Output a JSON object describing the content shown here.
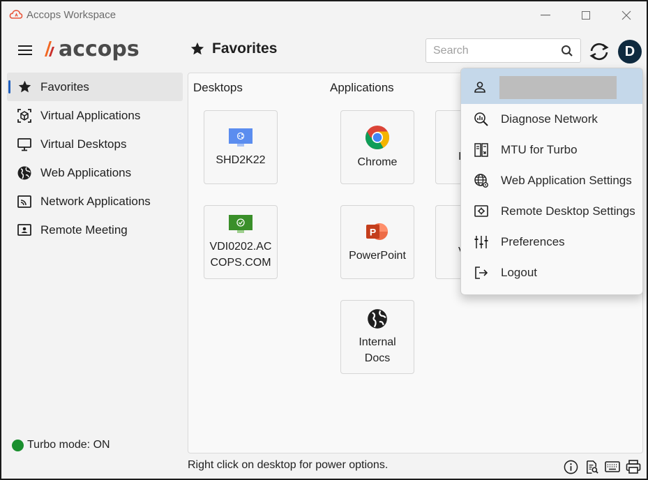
{
  "window": {
    "title": "Accops Workspace",
    "controls": [
      "minimize",
      "maximize",
      "close"
    ]
  },
  "header": {
    "logo_text": "accops",
    "page_title": "Favorites",
    "search_placeholder": "Search",
    "avatar_letter": "D"
  },
  "sidebar": {
    "items": [
      {
        "label": "Favorites",
        "icon": "star-icon",
        "active": true
      },
      {
        "label": "Virtual Applications",
        "icon": "cube-icon"
      },
      {
        "label": "Virtual Desktops",
        "icon": "monitor-icon"
      },
      {
        "label": "Web Applications",
        "icon": "globe-icon"
      },
      {
        "label": "Network Applications",
        "icon": "cast-icon"
      },
      {
        "label": "Remote Meeting",
        "icon": "presentation-icon"
      }
    ],
    "turbo_status": "Turbo mode: ON",
    "turbo_color": "#1a8f2e"
  },
  "main": {
    "desktops_heading": "Desktops",
    "applications_heading": "Applications",
    "desktops": [
      {
        "label": "SHD2K22",
        "icon": "shared-desktop-icon",
        "color": "#5b8def"
      },
      {
        "label": "VDI0202.AC\nCOPS.COM",
        "icon": "vdi-desktop-icon",
        "color": "#3a8f2a"
      }
    ],
    "applications": [
      {
        "label": "Chrome",
        "icon": "chrome-icon"
      },
      {
        "label": "PowerPoint",
        "icon": "powerpoint-icon"
      },
      {
        "label": "Internal\nDocs",
        "icon": "globe-icon"
      }
    ],
    "partial_tile_letters": [
      "I",
      "V"
    ]
  },
  "footer": {
    "hint": "Right click on desktop for power options.",
    "icons": [
      "info-icon",
      "logs-icon",
      "keyboard-icon",
      "printer-icon"
    ]
  },
  "user_menu": {
    "items": [
      {
        "label": "Diagnose Network",
        "icon": "diagnose-icon"
      },
      {
        "label": "MTU for Turbo",
        "icon": "mtu-icon"
      },
      {
        "label": "Web Application Settings",
        "icon": "web-settings-icon"
      },
      {
        "label": "Remote Desktop Settings",
        "icon": "desktop-settings-icon"
      },
      {
        "label": "Preferences",
        "icon": "sliders-icon"
      },
      {
        "label": "Logout",
        "icon": "logout-icon"
      }
    ],
    "highlight_color": "#c5d8ea"
  },
  "colors": {
    "accent": "#1f5fbf",
    "logo_orange": "#f26722",
    "avatar_bg": "#0f2a3f"
  }
}
